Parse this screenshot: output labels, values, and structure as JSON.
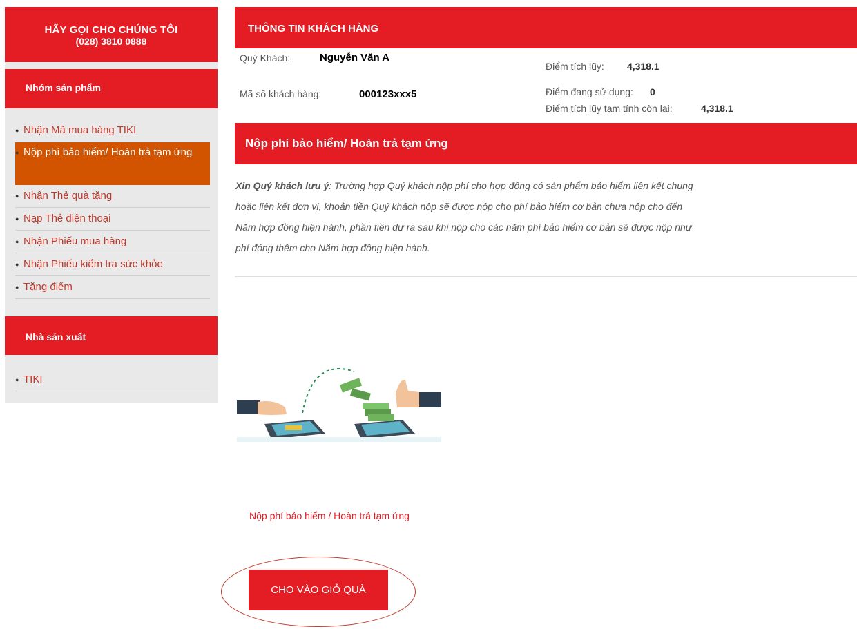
{
  "sidebar": {
    "call_line1": "HÃY GỌI CHO CHÚNG TÔI",
    "call_line2": "(028) 3810 0888",
    "product_group_title": "Nhóm sản phẩm",
    "product_items": [
      {
        "label": "Nhận Mã mua hàng TIKI"
      },
      {
        "label": "Nộp phí bảo hiểm/ Hoàn trả tạm ứng"
      },
      {
        "label": "Nhận Thẻ quà tặng"
      },
      {
        "label": "Nạp Thẻ điện thoại"
      },
      {
        "label": "Nhận Phiếu mua hàng"
      },
      {
        "label": "Nhận Phiếu kiểm tra sức khỏe"
      },
      {
        "label": "Tặng điểm"
      }
    ],
    "manufacturer_title": "Nhà sản xuất",
    "manufacturer_items": [
      {
        "label": "TIKI"
      }
    ]
  },
  "customer": {
    "section_title": "THÔNG TIN KHÁCH HÀNG",
    "name_label": "Quý Khách:",
    "name_value": "Nguyễn Văn A",
    "id_label": "Mã số khách hàng:",
    "id_value": "000123xxx5",
    "points_label": "Điểm tích lũy:",
    "points_value": "4,318.1",
    "used_label": "Điểm đang sử dụng:",
    "used_value": "0",
    "remaining_label": "Điểm tích lũy tạm tính còn lại:",
    "remaining_value": "4,318.1"
  },
  "payment": {
    "section_title": "Nộp phí bảo hiểm/ Hoàn trả tạm ứng",
    "note_lead": "Xin Quý khách lưu ý",
    "note_lines": [
      ": Trường hợp Quý khách nộp phí cho hợp đồng có sản phẩm bảo hiểm liên kết chung",
      "hoặc liên kết đơn vị, khoản tiền Quý khách nộp sẽ được nộp cho phí bảo hiểm cơ bản chưa nộp cho đến",
      "Năm hợp đồng hiện hành, phần tiền dư ra sau khi nộp cho các năm phí bảo hiểm cơ bản sẽ được nộp như",
      "phí đóng thêm cho Năm hợp đồng hiện hành."
    ],
    "product_label": "Nộp phí bảo hiểm / Hoàn trả tạm ứng",
    "cart_button": "CHO VÀO GIỎ QUÀ"
  }
}
